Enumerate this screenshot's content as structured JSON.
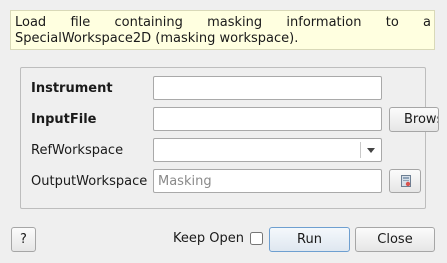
{
  "description": {
    "line1": "Load file containing masking information to a",
    "line2": "SpecialWorkspace2D (masking workspace)."
  },
  "form": {
    "instrument": {
      "label": "Instrument",
      "value": ""
    },
    "input_file": {
      "label": "InputFile",
      "value": "",
      "browse_label": "Browse"
    },
    "ref_workspace": {
      "label": "RefWorkspace",
      "selected": ""
    },
    "output_workspace": {
      "label": "OutputWorkspace",
      "value": "",
      "placeholder": "Masking",
      "icon": "workspace-picker-icon"
    }
  },
  "footer": {
    "help_label": "?",
    "keep_open_label": "Keep Open",
    "keep_open_checked": false,
    "run_label": "Run",
    "close_label": "Close"
  },
  "colors": {
    "description_bg": "#ffffe0",
    "window_bg": "#efefef",
    "run_border": "#6e9fd0"
  }
}
